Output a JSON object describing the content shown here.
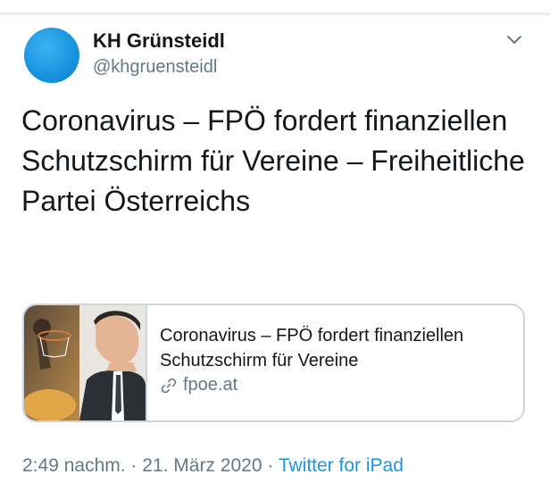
{
  "user": {
    "display_name": "KH Grünsteidl",
    "handle": "@khgruensteidl",
    "avatar_color": "#1da1f2"
  },
  "tweet": {
    "text": "Coronavirus – FPÖ fordert finanziellen Schutzschirm für Vereine – Freiheitliche Partei Österreichs"
  },
  "card": {
    "title": "Coronavirus – FPÖ fordert finanziellen Schutzschirm für Vereine",
    "domain": "fpoe.at",
    "domain_icon": "link-icon"
  },
  "meta": {
    "time": "2:49 nachm.",
    "separator": "·",
    "date": "21. März 2020",
    "source": "Twitter for iPad"
  },
  "colors": {
    "accent": "#1b95e0",
    "secondary_text": "#657786",
    "border": "#ccd6dd"
  }
}
